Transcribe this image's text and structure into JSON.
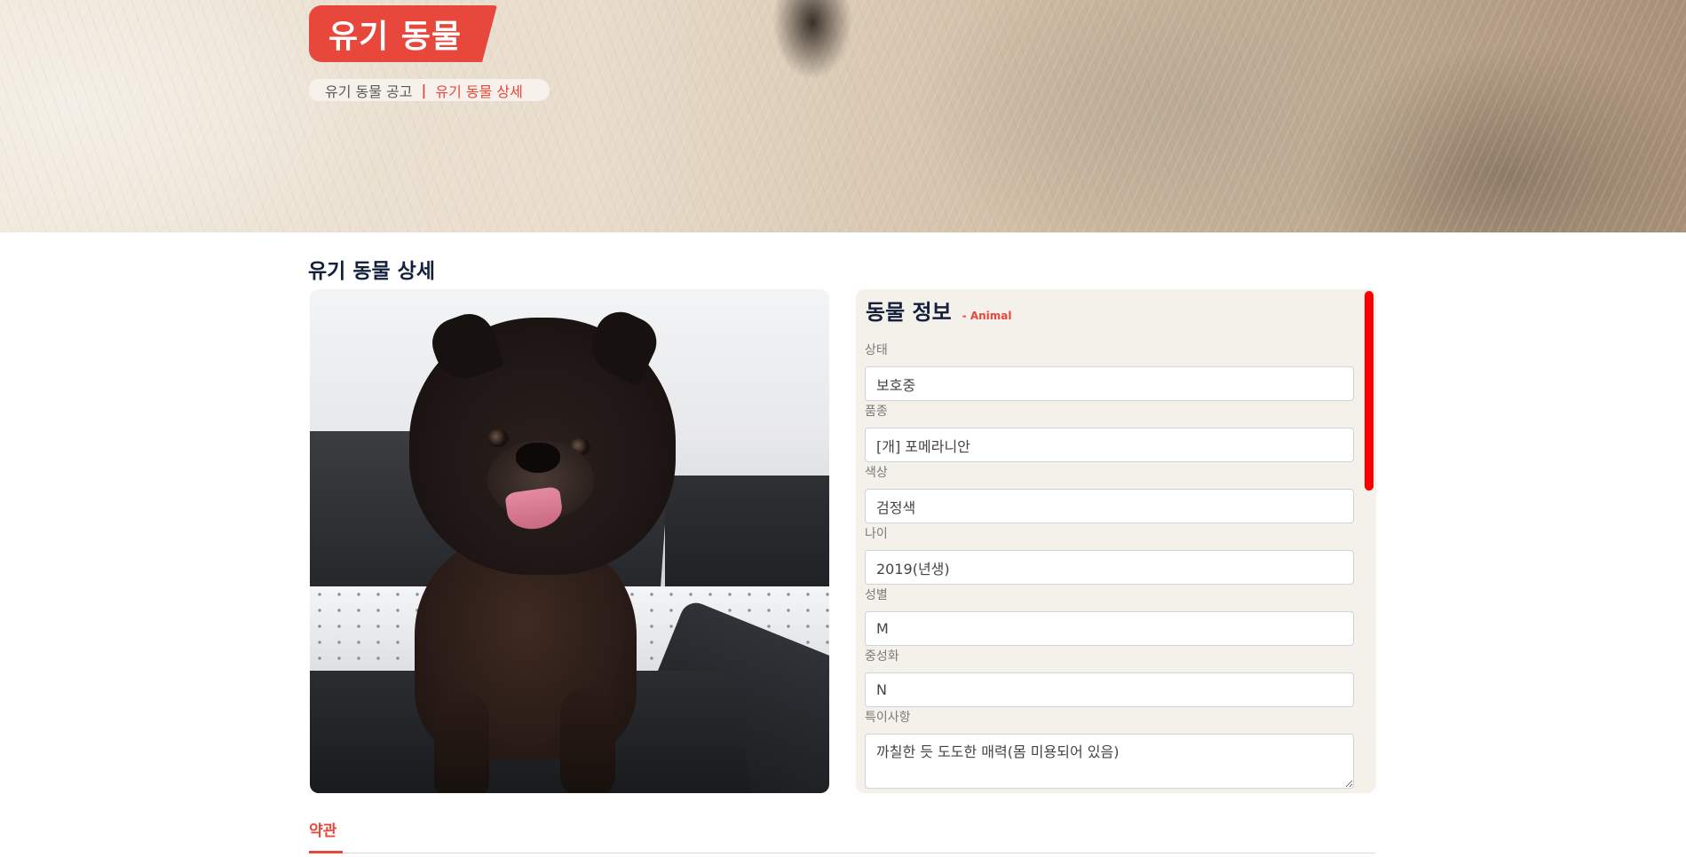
{
  "hero": {
    "title": "유기 동물",
    "breadcrumb": [
      "유기 동물 공고",
      "유기 동물 상세"
    ],
    "breadcrumb_separator": "|"
  },
  "main": {
    "page_title": "유기 동물 상세",
    "photo_alt": "검정색 포메라니안 사진"
  },
  "info": {
    "title": "동물 정보",
    "subtitle": "- Animal",
    "fields": [
      {
        "label": "상태",
        "value": "보호중"
      },
      {
        "label": "품종",
        "value": "[개] 포메라니안"
      },
      {
        "label": "색상",
        "value": "검정색"
      },
      {
        "label": "나이",
        "value": "2019(년생)"
      },
      {
        "label": "성별",
        "value": "M"
      },
      {
        "label": "중성화",
        "value": "N"
      },
      {
        "label": "특이사항",
        "value": "까칠한 듯 도도한 매력(몸 미용되어 있음)"
      }
    ]
  },
  "tabs": [
    {
      "label": "약관",
      "active": true
    }
  ],
  "colors": {
    "accent": "#e8473b",
    "heading": "#14213d",
    "panel_bg": "#f4f0ea",
    "scrollbar": "#ff0000"
  }
}
